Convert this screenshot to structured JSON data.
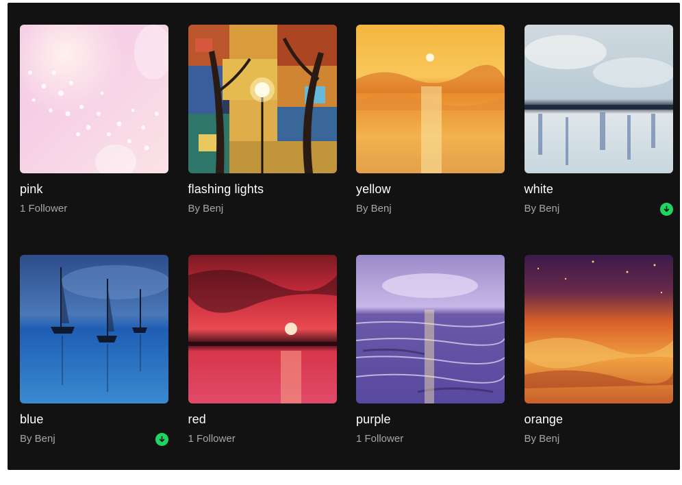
{
  "playlists": [
    {
      "title": "pink",
      "subtitle": "1 Follower",
      "downloaded": false
    },
    {
      "title": "flashing lights",
      "subtitle": "By Benj",
      "downloaded": false
    },
    {
      "title": "yellow",
      "subtitle": "By Benj",
      "downloaded": false
    },
    {
      "title": "white",
      "subtitle": "By Benj",
      "downloaded": true
    },
    {
      "title": "blue",
      "subtitle": "By Benj",
      "downloaded": true
    },
    {
      "title": "red",
      "subtitle": "1 Follower",
      "downloaded": false
    },
    {
      "title": "purple",
      "subtitle": "1 Follower",
      "downloaded": false
    },
    {
      "title": "orange",
      "subtitle": "By Benj",
      "downloaded": false
    }
  ],
  "icons": {
    "downloaded": "download-arrow-icon"
  },
  "colors": {
    "background": "#121212",
    "title": "#ffffff",
    "subtitle": "#a7a7a7",
    "download_badge": "#1ed760"
  }
}
